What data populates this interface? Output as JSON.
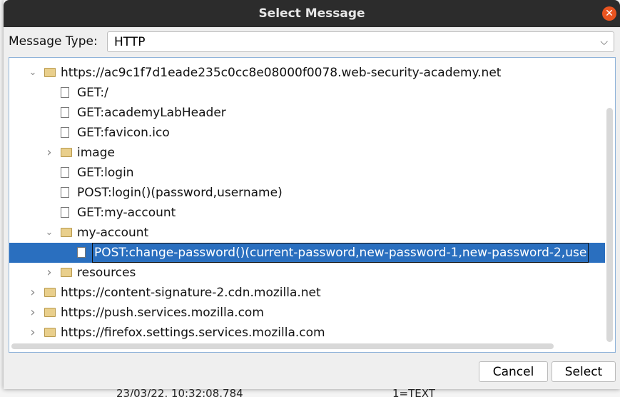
{
  "dialog": {
    "title": "Select Message"
  },
  "message_type": {
    "label": "Message Type:",
    "value": "HTTP"
  },
  "tree": [
    {
      "label": "https://ac9c1f7d1eade235c0cc8e08000f0078.web-security-academy.net",
      "level": 0,
      "type": "folder",
      "expanded": true
    },
    {
      "label": "GET:/",
      "level": 1,
      "type": "file"
    },
    {
      "label": "GET:academyLabHeader",
      "level": 1,
      "type": "file"
    },
    {
      "label": "GET:favicon.ico",
      "level": 1,
      "type": "file"
    },
    {
      "label": "image",
      "level": 1,
      "type": "folder",
      "expanded": false
    },
    {
      "label": "GET:login",
      "level": 1,
      "type": "file"
    },
    {
      "label": "POST:login()(password,username)",
      "level": 1,
      "type": "file"
    },
    {
      "label": "GET:my-account",
      "level": 1,
      "type": "file"
    },
    {
      "label": "my-account",
      "level": 1,
      "type": "folder",
      "expanded": true
    },
    {
      "label": "POST:change-password()(current-password,new-password-1,new-password-2,use",
      "level": 2,
      "type": "file",
      "selected": true
    },
    {
      "label": "resources",
      "level": 1,
      "type": "folder",
      "expanded": false
    },
    {
      "label": "https://content-signature-2.cdn.mozilla.net",
      "level": 0,
      "type": "folder",
      "expanded": false
    },
    {
      "label": "https://push.services.mozilla.com",
      "level": 0,
      "type": "folder",
      "expanded": false
    },
    {
      "label": "https://firefox.settings.services.mozilla.com",
      "level": 0,
      "type": "folder",
      "expanded": false
    }
  ],
  "buttons": {
    "cancel": "Cancel",
    "select": "Select"
  },
  "background": {
    "timestamp": "23/03/22, 10:32:08.784",
    "type": "1=TEXT"
  },
  "colors": {
    "selection": "#2a6fbf",
    "titlebar": "#2c2c2c",
    "close": "#e95420"
  }
}
